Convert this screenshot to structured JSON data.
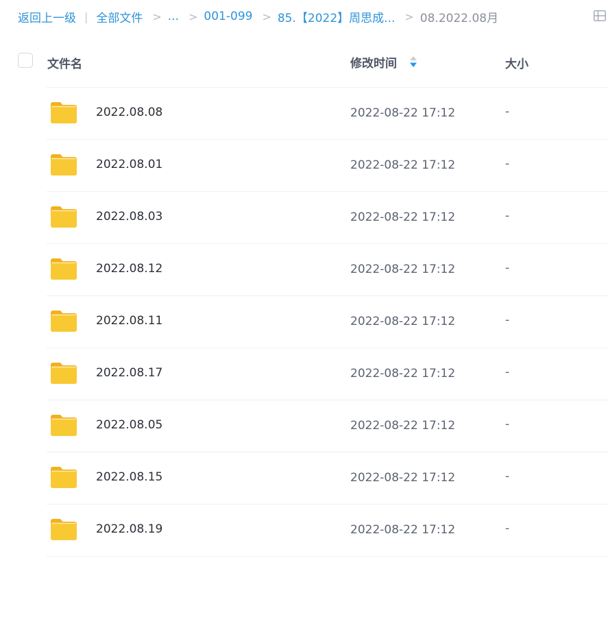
{
  "breadcrumb": {
    "back": "返回上一级",
    "divider": "|",
    "sep": ">",
    "items": [
      {
        "label": "全部文件",
        "link": true
      },
      {
        "label": "...",
        "link": true
      },
      {
        "label": "001-099",
        "link": true
      },
      {
        "label": "85.【2022】周思成...",
        "link": true
      },
      {
        "label": "08.2022.08月",
        "link": false
      }
    ]
  },
  "view_toggle_icon": "grid-list-icon",
  "header": {
    "name": "文件名",
    "mtime": "修改时间",
    "size": "大小",
    "sort_icon": "sort-icon"
  },
  "colors": {
    "link": "#2f93d8",
    "folder": "#f9c933",
    "folder_dark": "#f1b11f",
    "sort_active": "#1e9bf0"
  },
  "files": [
    {
      "name": "2022.08.08",
      "mtime": "2022-08-22 17:12",
      "size": "-",
      "icon": "folder-icon"
    },
    {
      "name": "2022.08.01",
      "mtime": "2022-08-22 17:12",
      "size": "-",
      "icon": "folder-icon"
    },
    {
      "name": "2022.08.03",
      "mtime": "2022-08-22 17:12",
      "size": "-",
      "icon": "folder-icon"
    },
    {
      "name": "2022.08.12",
      "mtime": "2022-08-22 17:12",
      "size": "-",
      "icon": "folder-icon"
    },
    {
      "name": "2022.08.11",
      "mtime": "2022-08-22 17:12",
      "size": "-",
      "icon": "folder-icon"
    },
    {
      "name": "2022.08.17",
      "mtime": "2022-08-22 17:12",
      "size": "-",
      "icon": "folder-icon"
    },
    {
      "name": "2022.08.05",
      "mtime": "2022-08-22 17:12",
      "size": "-",
      "icon": "folder-icon"
    },
    {
      "name": "2022.08.15",
      "mtime": "2022-08-22 17:12",
      "size": "-",
      "icon": "folder-icon"
    },
    {
      "name": "2022.08.19",
      "mtime": "2022-08-22 17:12",
      "size": "-",
      "icon": "folder-icon"
    }
  ]
}
